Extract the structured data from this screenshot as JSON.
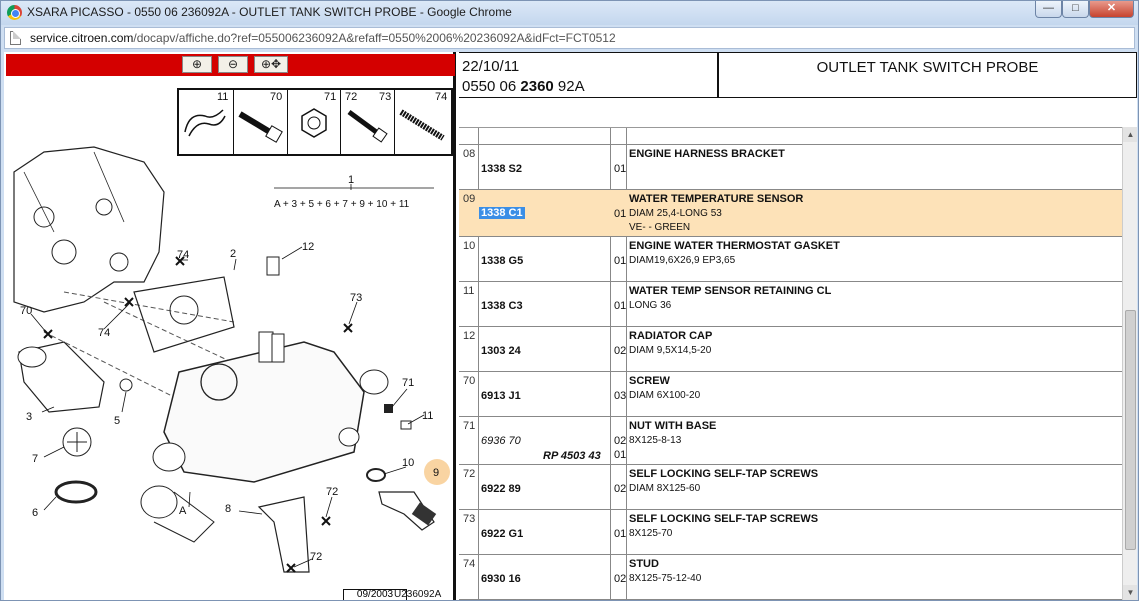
{
  "window": {
    "title": "XSARA PICASSO - 0550 06 236092A - OUTLET TANK SWITCH PROBE - Google Chrome",
    "min": "—",
    "max": "□",
    "close": "✕"
  },
  "address": {
    "domain": "service.citroen.com",
    "path": "/docapv/affiche.do?ref=055006236092A&refaff=0550%2006%20236092A&idFct=FCT0512"
  },
  "toolbar": {
    "zoom_in": "⊕",
    "zoom_out": "⊖",
    "pan": "⊕✥"
  },
  "diagram": {
    "strip_numbers": [
      "11",
      "70",
      "71",
      "72",
      "73",
      "74"
    ],
    "callouts": [
      "1",
      "A + 3 + 5 + 6 + 7 + 9 + 10 + 11",
      "74",
      "2",
      "12",
      "73",
      "70",
      "74",
      "3",
      "5",
      "71",
      "11",
      "7",
      "10",
      "9",
      "6",
      "A",
      "8",
      "72",
      "72"
    ],
    "footer_date": "09/2003",
    "footer_ref": "U236092A"
  },
  "header": {
    "date": "22/10/11",
    "ref_prefix": "0550 06 ",
    "ref_bold": "2360",
    "ref_suffix": " 92A",
    "title": "OUTLET TANK SWITCH PROBE"
  },
  "rows": [
    {
      "idx": "08",
      "code": "1338 S2",
      "sub": "",
      "qty": "01",
      "name": "ENGINE HARNESS BRACKET",
      "details": []
    },
    {
      "idx": "09",
      "code": "1338 C1",
      "sub": "",
      "qty": "01",
      "name": "WATER TEMPERATURE SENSOR",
      "details": [
        "DIAM 25,4-LONG 53",
        "VE- - GREEN"
      ]
    },
    {
      "idx": "10",
      "code": "1338 G5",
      "sub": "",
      "qty": "01",
      "name": "ENGINE WATER THERMOSTAT GASKET",
      "details": [
        "DIAM19,6X26,9 EP3,65"
      ]
    },
    {
      "idx": "11",
      "code": "1338 C3",
      "sub": "",
      "qty": "01",
      "name": "WATER TEMP SENSOR RETAINING CL",
      "details": [
        "LONG 36"
      ]
    },
    {
      "idx": "12",
      "code": "1303 24",
      "sub": "",
      "qty": "02",
      "name": "RADIATOR CAP",
      "details": [
        "DIAM 9,5X14,5-20"
      ]
    },
    {
      "idx": "70",
      "code": "6913 J1",
      "sub": "",
      "qty": "03",
      "name": "SCREW",
      "details": [
        "DIAM 6X100-20"
      ]
    },
    {
      "idx": "71",
      "code": "6936 70",
      "sub": "RP 4503 43",
      "qty": "02",
      "qty2": "01",
      "name": "NUT WITH BASE",
      "details": [
        "8X125-8-13"
      ]
    },
    {
      "idx": "72",
      "code": "6922 89",
      "sub": "",
      "qty": "02",
      "name": "SELF LOCKING SELF-TAP SCREWS",
      "details": [
        "DIAM 8X125-60"
      ]
    },
    {
      "idx": "73",
      "code": "6922 G1",
      "sub": "",
      "qty": "01",
      "name": "SELF LOCKING SELF-TAP SCREWS",
      "details": [
        "8X125-70"
      ]
    },
    {
      "idx": "74",
      "code": "6930 16",
      "sub": "",
      "qty": "02",
      "name": "STUD",
      "details": [
        "8X125-75-12-40"
      ]
    }
  ],
  "scroll": {
    "up": "▲",
    "down": "▼"
  }
}
